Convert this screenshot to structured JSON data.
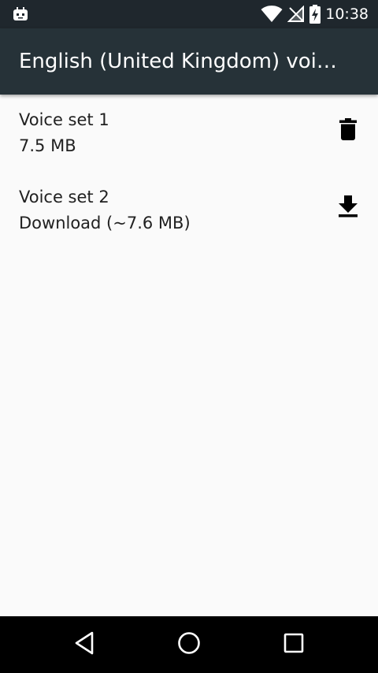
{
  "status_bar": {
    "time": "10:38",
    "left_icons": [
      "android-notification-icon"
    ],
    "right_icons": [
      "wifi-icon",
      "no-signal-icon",
      "battery-charging-icon"
    ]
  },
  "app_bar": {
    "title": "English (United Kingdom) voi…"
  },
  "voice_sets": [
    {
      "title": "Voice set 1",
      "subtitle": "7.5 MB",
      "action_icon": "delete-icon"
    },
    {
      "title": "Voice set 2",
      "subtitle": "Download (~7.6 MB)",
      "action_icon": "download-icon"
    }
  ],
  "navigation": {
    "buttons": [
      "back-icon",
      "home-icon",
      "recents-icon"
    ]
  },
  "colors": {
    "status_bar": "#1f272d",
    "app_bar": "#263238",
    "background": "#fafafa",
    "text_primary": "#212121",
    "nav_bar": "#000000"
  }
}
